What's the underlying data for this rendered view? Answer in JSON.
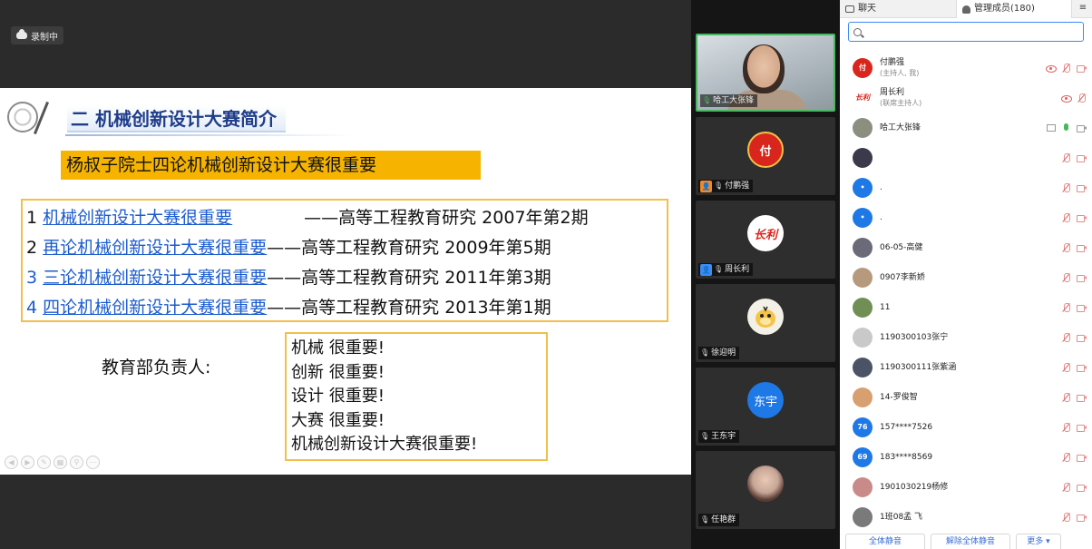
{
  "recording": {
    "label": "录制中"
  },
  "slide": {
    "title": "二  机械创新设计大赛简介",
    "banner": "杨叔子院士四论机械创新设计大赛很重要",
    "papers": [
      {
        "num": "1",
        "title": "机械创新设计大赛很重要",
        "source": "——高等工程教育研究  2007年第2期"
      },
      {
        "num": "2",
        "title": "再论机械创新设计大赛很重要",
        "source": "——高等工程教育研究  2009年第5期"
      },
      {
        "num": "3",
        "title": "三论机械创新设计大赛很重要",
        "source": "——高等工程教育研究  2011年第3期"
      },
      {
        "num": "4",
        "title": "四论机械创新设计大赛很重要",
        "source": "——高等工程教育研究  2013年第1期"
      }
    ],
    "moe_label": "教育部负责人:",
    "moe_lines": [
      "机械 很重要!",
      "创新 很重要!",
      "设计 很重要!",
      "大赛 很重要!",
      "机械创新设计大赛很重要!"
    ]
  },
  "videos": [
    {
      "name": "哈工大张锋",
      "type": "camera",
      "active": true
    },
    {
      "name": "付鹏强",
      "type": "avatar",
      "avatar_text": "付",
      "avatar_color": "#d9261c",
      "role_color": "#f08a24"
    },
    {
      "name": "周长利",
      "type": "avatar",
      "avatar_text": "长利",
      "avatar_color": "#ffffff",
      "role_color": "#3b8cf3"
    },
    {
      "name": "徐迎明",
      "type": "avatar",
      "avatar_text": "",
      "avatar_color": "#f3f0e8"
    },
    {
      "name": "王东宇",
      "type": "avatar",
      "avatar_text": "东宇",
      "avatar_color": "#1e78e6"
    },
    {
      "name": "任艳群",
      "type": "avatar",
      "avatar_text": "",
      "avatar_color": "#c7a697"
    }
  ],
  "panel": {
    "tabs": {
      "chat": "聊天",
      "members": "管理成员(180)"
    },
    "search_placeholder": "",
    "members": [
      {
        "name": "付鹏强",
        "role": "(主持人, 我)",
        "avatar_color": "#d9261c",
        "avatar_text": "付",
        "icons": [
          "eye",
          "mic-off",
          "cam-off"
        ]
      },
      {
        "name": "周长利",
        "role": "(联席主持人)",
        "avatar_color": "#ffffff",
        "avatar_text": "长利",
        "icons": [
          "eye",
          "mic-off"
        ]
      },
      {
        "name": "哈工大张锋",
        "role": "",
        "avatar_color": "#8a8f80",
        "avatar_text": "",
        "icons": [
          "screen",
          "mic-on",
          "cam-on"
        ]
      },
      {
        "name": "",
        "role": "",
        "avatar_color": "#3a3a4a",
        "avatar_text": "",
        "icons": [
          "mic-off",
          "cam-off"
        ]
      },
      {
        "name": ".",
        "role": "",
        "avatar_color": "#1e78e6",
        "avatar_text": "•",
        "icons": [
          "mic-off",
          "cam-off"
        ]
      },
      {
        "name": ".",
        "role": "",
        "avatar_color": "#1e78e6",
        "avatar_text": "•",
        "icons": [
          "mic-off",
          "cam-off"
        ]
      },
      {
        "name": "06-05-高健",
        "role": "",
        "avatar_color": "#6a6a78",
        "avatar_text": "",
        "icons": [
          "mic-off",
          "cam-off"
        ]
      },
      {
        "name": "0907李新娇",
        "role": "",
        "avatar_color": "#b79a7d",
        "avatar_text": "",
        "icons": [
          "mic-off",
          "cam-off"
        ]
      },
      {
        "name": "11",
        "role": "",
        "avatar_color": "#6f8f54",
        "avatar_text": "",
        "icons": [
          "mic-off",
          "cam-off"
        ]
      },
      {
        "name": "1190300103张宁",
        "role": "",
        "avatar_color": "#c9c9c9",
        "avatar_text": "",
        "icons": [
          "mic-off",
          "cam-off"
        ]
      },
      {
        "name": "1190300111张紫涵",
        "role": "",
        "avatar_color": "#4b5466",
        "avatar_text": "",
        "icons": [
          "mic-off",
          "cam-off"
        ]
      },
      {
        "name": "14-罗俊智",
        "role": "",
        "avatar_color": "#d8a070",
        "avatar_text": "",
        "icons": [
          "mic-off",
          "cam-off"
        ]
      },
      {
        "name": "157****7526",
        "role": "",
        "avatar_color": "#1e78e6",
        "avatar_text": "76",
        "icons": [
          "mic-off",
          "cam-off"
        ]
      },
      {
        "name": "183****8569",
        "role": "",
        "avatar_color": "#1e78e6",
        "avatar_text": "69",
        "icons": [
          "mic-off",
          "cam-off"
        ]
      },
      {
        "name": "1901030219杨修",
        "role": "",
        "avatar_color": "#c98a8a",
        "avatar_text": "",
        "icons": [
          "mic-off",
          "cam-off"
        ]
      },
      {
        "name": "1班08孟  飞",
        "role": "",
        "avatar_color": "#7a7a7a",
        "avatar_text": "",
        "icons": [
          "mic-off",
          "cam-off"
        ]
      }
    ],
    "footer": {
      "mute_all": "全体静音",
      "unmute_all": "解除全体静音",
      "more": "更多 ▾"
    }
  }
}
